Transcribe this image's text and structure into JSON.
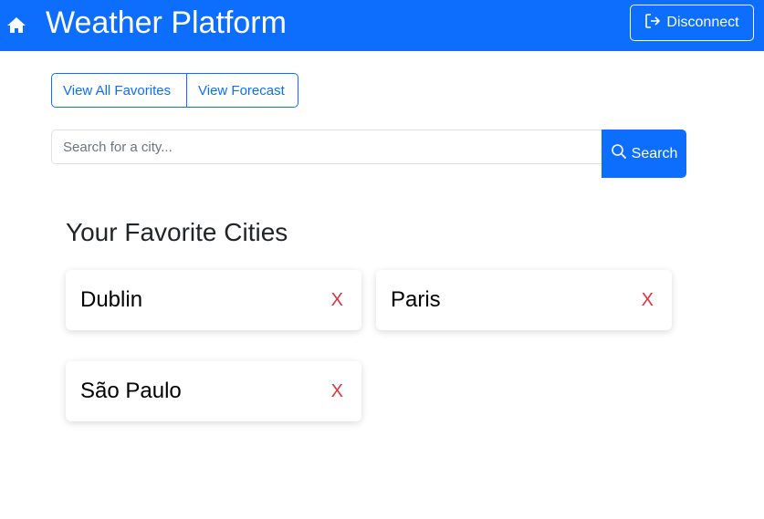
{
  "navbar": {
    "brand": "Weather Platform",
    "home_icon": "home-icon",
    "disconnect_label": "Disconnect",
    "disconnect_icon": "logout-icon",
    "background": "#0d6efd"
  },
  "nav_buttons": {
    "favorites_label": "View All Favorites",
    "forecast_label": "View Forecast"
  },
  "search": {
    "placeholder": "Search for a city...",
    "value": "",
    "button_label": "Search",
    "button_icon": "search-icon"
  },
  "favorites": {
    "title": "Your Favorite Cities",
    "cities": [
      {
        "name": "Dublin",
        "remove_label": "X"
      },
      {
        "name": "Paris",
        "remove_label": "X"
      },
      {
        "name": "São Paulo",
        "remove_label": "X"
      }
    ]
  },
  "colors": {
    "primary": "#0d6efd",
    "danger": "#dc3545"
  }
}
